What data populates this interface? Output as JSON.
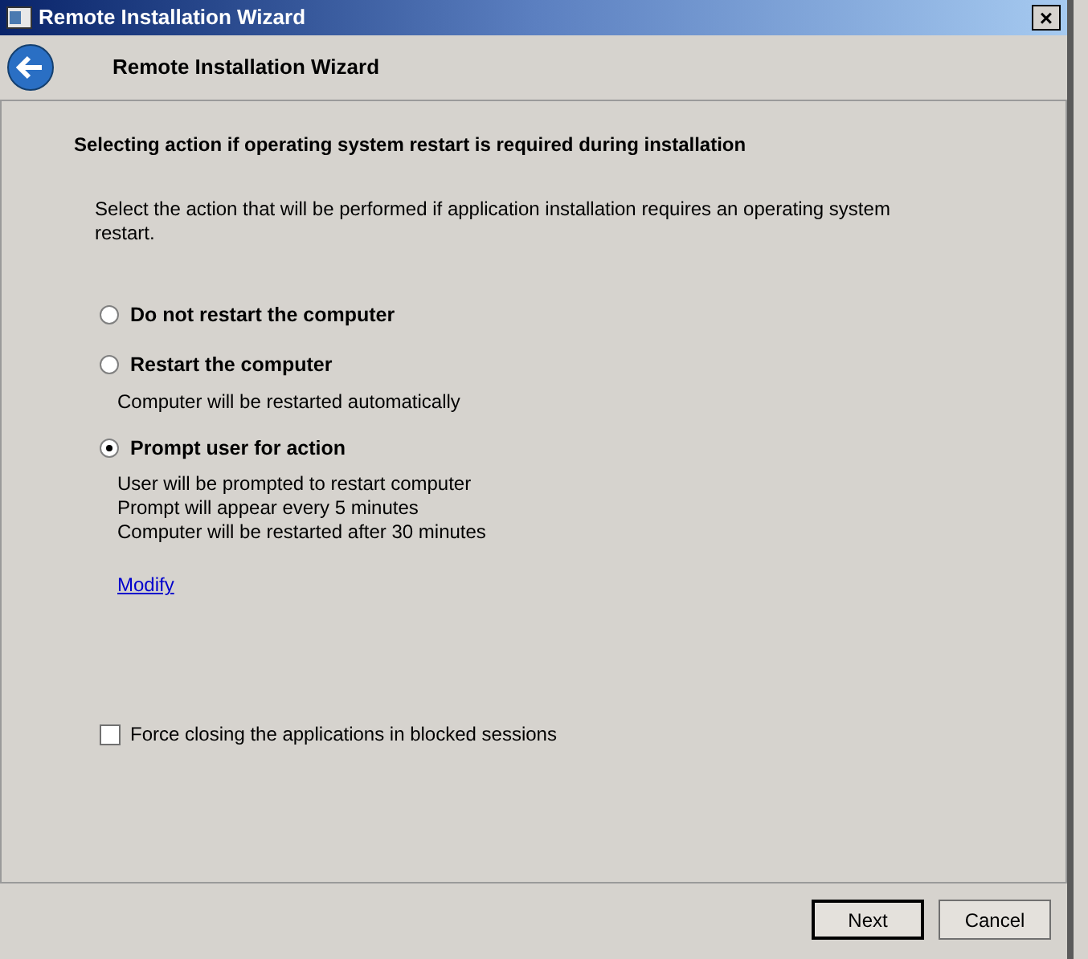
{
  "window": {
    "title": "Remote Installation Wizard",
    "close": "×"
  },
  "header": {
    "title": "Remote Installation Wizard"
  },
  "heading": "Selecting action if operating system restart is required during installation",
  "description": "Select the action that will be performed if application installation requires an operating system restart.",
  "options": [
    {
      "label": "Do not restart the computer",
      "selected": false
    },
    {
      "label": "Restart the computer",
      "selected": false,
      "details": [
        "Computer will be restarted automatically"
      ]
    },
    {
      "label": "Prompt user for action",
      "selected": true,
      "details": [
        "User will be prompted to restart computer",
        "Prompt will appear every 5 minutes",
        "Computer will be restarted after 30 minutes"
      ]
    }
  ],
  "link": "Modify",
  "force_close": {
    "label": "Force closing the applications in blocked sessions",
    "checked": false
  },
  "buttons": [
    {
      "label": "Next",
      "default": true
    },
    {
      "label": "Cancel",
      "default": false
    }
  ]
}
